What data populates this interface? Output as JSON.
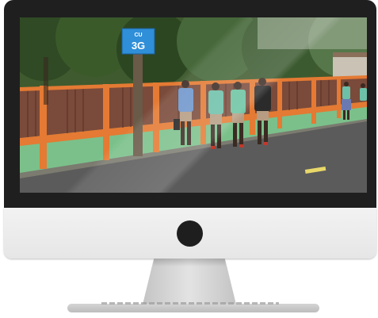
{
  "sign": {
    "top": "CU",
    "main": "3G"
  }
}
